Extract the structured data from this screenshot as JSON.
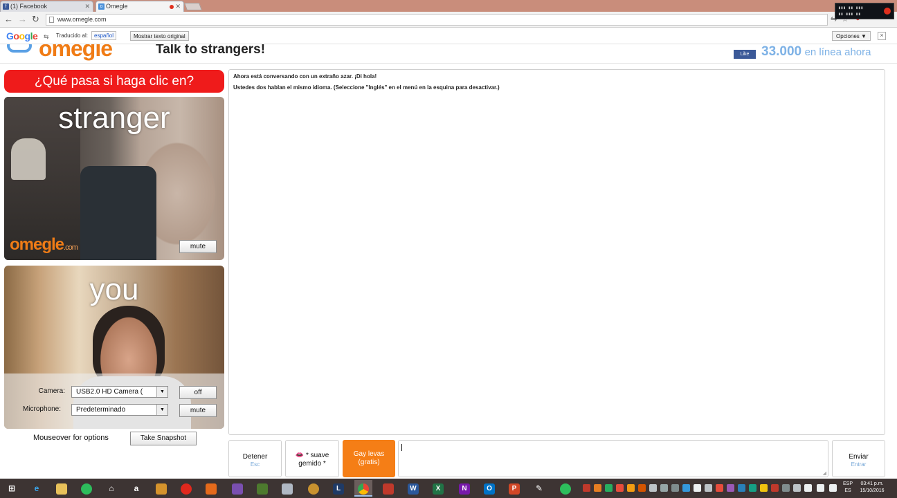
{
  "browser": {
    "tabs": [
      {
        "label": "(1) Facebook",
        "icon": "facebook-icon",
        "color": "#3b5998"
      },
      {
        "label": "Omegle",
        "icon": "omegle-icon",
        "color": "#4a90d9"
      }
    ],
    "url": "www.omegle.com"
  },
  "translate": {
    "label": "Traducido al:",
    "language": "español",
    "show_original": "Mostrar texto original",
    "options": "Opciones ▼"
  },
  "header": {
    "brand": "omegle",
    "tagline": "Talk to strangers!",
    "fb_like": "Like",
    "online_count": "33.000",
    "online_label": "en línea ahora"
  },
  "ad_banner": "¿Qué pasa si haga clic en?",
  "stranger_video": {
    "label": "stranger",
    "watermark": "omegle",
    "watermark_suffix": ".com",
    "mute": "mute"
  },
  "you_video": {
    "label": "you",
    "camera_label": "Camera:",
    "camera_value": "USB2.0 HD Camera (",
    "camera_btn": "off",
    "mic_label": "Microphone:",
    "mic_value": "Predeterminado",
    "mic_btn": "mute"
  },
  "below_video": {
    "mouseover": "Mouseover for options",
    "snapshot": "Take Snapshot"
  },
  "chat": {
    "messages": [
      "Ahora está conversando con un extraño azar. ¡Di hola!",
      "Ustedes dos hablan el mismo idioma. (Seleccione \"Inglés\" en el menú en la esquina para desactivar.)"
    ]
  },
  "chatbar": {
    "stop": "Detener",
    "stop_key": "Esc",
    "ad1": "* suave gemido *",
    "ad2": "Gay levas (gratis)",
    "send": "Enviar",
    "send_key": "Entrar"
  },
  "taskbar": {
    "lang_top": "ESP",
    "lang_bottom": "ES",
    "time": "03:41 p.m.",
    "date": "15/10/2016"
  },
  "colors": {
    "accent_orange": "#f57e16",
    "banner_red": "#ef1b1b",
    "online_blue": "#7eb2e6"
  }
}
